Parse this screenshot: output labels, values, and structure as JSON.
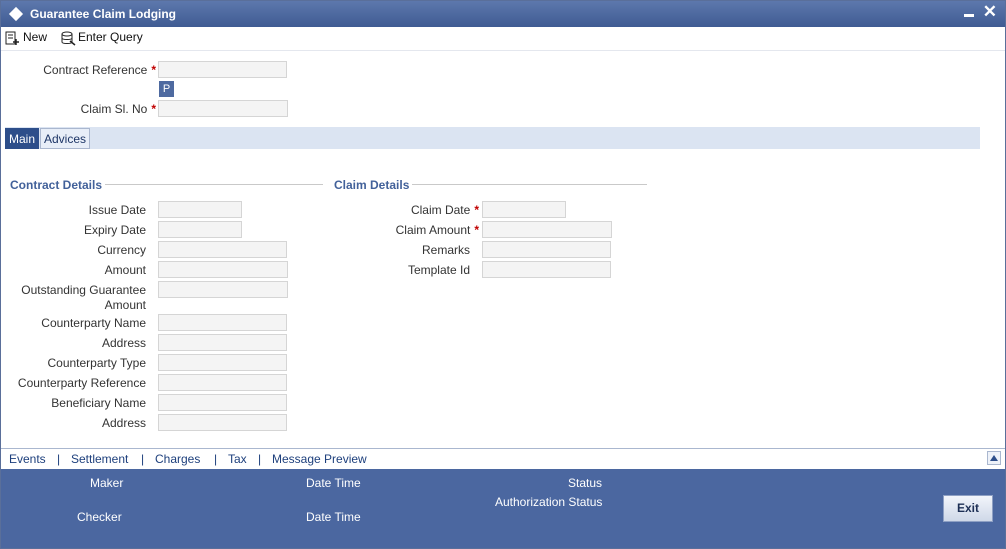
{
  "window": {
    "title": "Guarantee Claim Lodging",
    "close_glyph": "✕"
  },
  "toolbar": {
    "new_label": "New",
    "enter_query_label": "Enter Query"
  },
  "header": {
    "contract_reference_label": "Contract Reference",
    "p_button_label": "P",
    "claim_sl_no_label": "Claim Sl. No",
    "required_mark": "*"
  },
  "tabs": [
    {
      "label": "Main"
    },
    {
      "label": "Advices"
    }
  ],
  "contract_details": {
    "heading": "Contract Details",
    "fields": [
      {
        "label": "Issue Date",
        "value": ""
      },
      {
        "label": "Expiry Date",
        "value": ""
      },
      {
        "label": "Currency",
        "value": ""
      },
      {
        "label": "Amount",
        "value": ""
      },
      {
        "label": "Outstanding Guarantee",
        "label2": "Amount",
        "value": ""
      },
      {
        "label": "Counterparty Name",
        "value": ""
      },
      {
        "label": "Address",
        "value": ""
      },
      {
        "label": "Counterparty Type",
        "value": ""
      },
      {
        "label": "Counterparty Reference",
        "value": ""
      },
      {
        "label": "Beneficiary Name",
        "value": ""
      },
      {
        "label": "Address",
        "value": ""
      }
    ]
  },
  "claim_details": {
    "heading": "Claim Details",
    "fields": [
      {
        "label": "Claim Date",
        "required": true,
        "value": ""
      },
      {
        "label": "Claim Amount",
        "required": true,
        "value": ""
      },
      {
        "label": "Remarks",
        "value": ""
      },
      {
        "label": "Template Id",
        "value": ""
      }
    ]
  },
  "bottom_links": [
    {
      "label": "Events"
    },
    {
      "label": "Settlement"
    },
    {
      "label": "Charges"
    },
    {
      "label": "Tax"
    },
    {
      "label": "Message Preview"
    }
  ],
  "link_separator": "|",
  "footer": {
    "maker_label": "Maker",
    "checker_label": "Checker",
    "date_time_label": "Date Time",
    "status_label": "Status",
    "authorization_status_label": "Authorization Status",
    "exit_label": "Exit"
  },
  "colors": {
    "titlebar": "#4a66a0",
    "accent": "#2d4e8a",
    "section_heading": "#42619a",
    "required": "#c00000",
    "footer": "#4b67a0"
  }
}
